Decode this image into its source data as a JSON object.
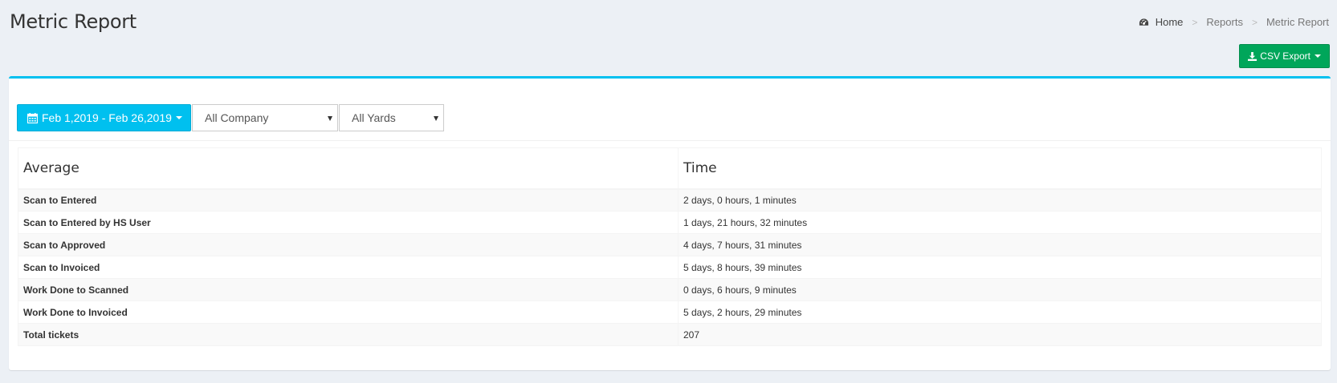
{
  "header": {
    "title": "Metric Report",
    "breadcrumb": [
      "Home",
      "Reports",
      "Metric Report"
    ],
    "separator": ">"
  },
  "toolbar": {
    "csv_export_label": "CSV Export"
  },
  "filters": {
    "date_range_label": "Feb 1,2019 - Feb 26,2019",
    "company_selected": "All Company",
    "yards_selected": "All Yards"
  },
  "table": {
    "columns": [
      "Average",
      "Time"
    ],
    "rows": [
      {
        "label": "Scan to Entered",
        "value": "2 days, 0 hours, 1 minutes"
      },
      {
        "label": "Scan to Entered by HS User",
        "value": "1 days, 21 hours, 32 minutes"
      },
      {
        "label": "Scan to Approved",
        "value": "4 days, 7 hours, 31 minutes"
      },
      {
        "label": "Scan to Invoiced",
        "value": "5 days, 8 hours, 39 minutes"
      },
      {
        "label": "Work Done to Scanned",
        "value": "0 days, 6 hours, 9 minutes"
      },
      {
        "label": "Work Done to Invoiced",
        "value": "5 days, 2 hours, 29 minutes"
      },
      {
        "label": "Total tickets",
        "value": "207"
      }
    ]
  },
  "colors": {
    "accent": "#00c0ef",
    "success": "#00a65a",
    "background": "#ecf0f5"
  },
  "icons": {
    "breadcrumb_home": "dashboard-icon",
    "csv_export": "download-icon",
    "date_range": "calendar-icon"
  }
}
